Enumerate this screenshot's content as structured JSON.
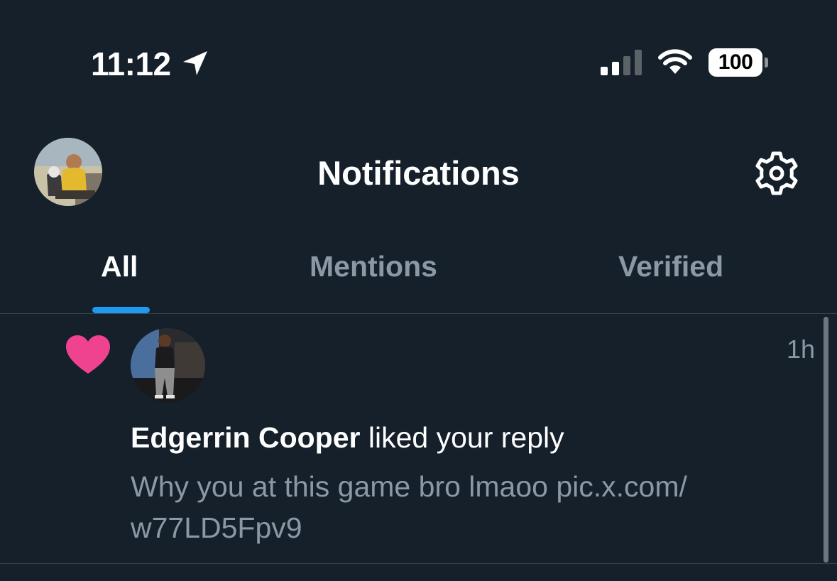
{
  "status_bar": {
    "time": "11:12",
    "battery": "100"
  },
  "header": {
    "title": "Notifications"
  },
  "tabs": [
    {
      "label": "All",
      "active": true
    },
    {
      "label": "Mentions",
      "active": false
    },
    {
      "label": "Verified",
      "active": false
    }
  ],
  "notifications": [
    {
      "icon": "heart-icon",
      "actor": "Edgerrin Cooper",
      "action": "liked your reply",
      "preview": "Why you at this game bro lmaoo pic.x.com/ w77LD5Fpv9",
      "time": "1h"
    }
  ],
  "colors": {
    "background": "#15202b",
    "accent": "#1d9bf0",
    "heart": "#f0438f",
    "muted_text": "#8b98a5",
    "divider": "#38444d"
  }
}
